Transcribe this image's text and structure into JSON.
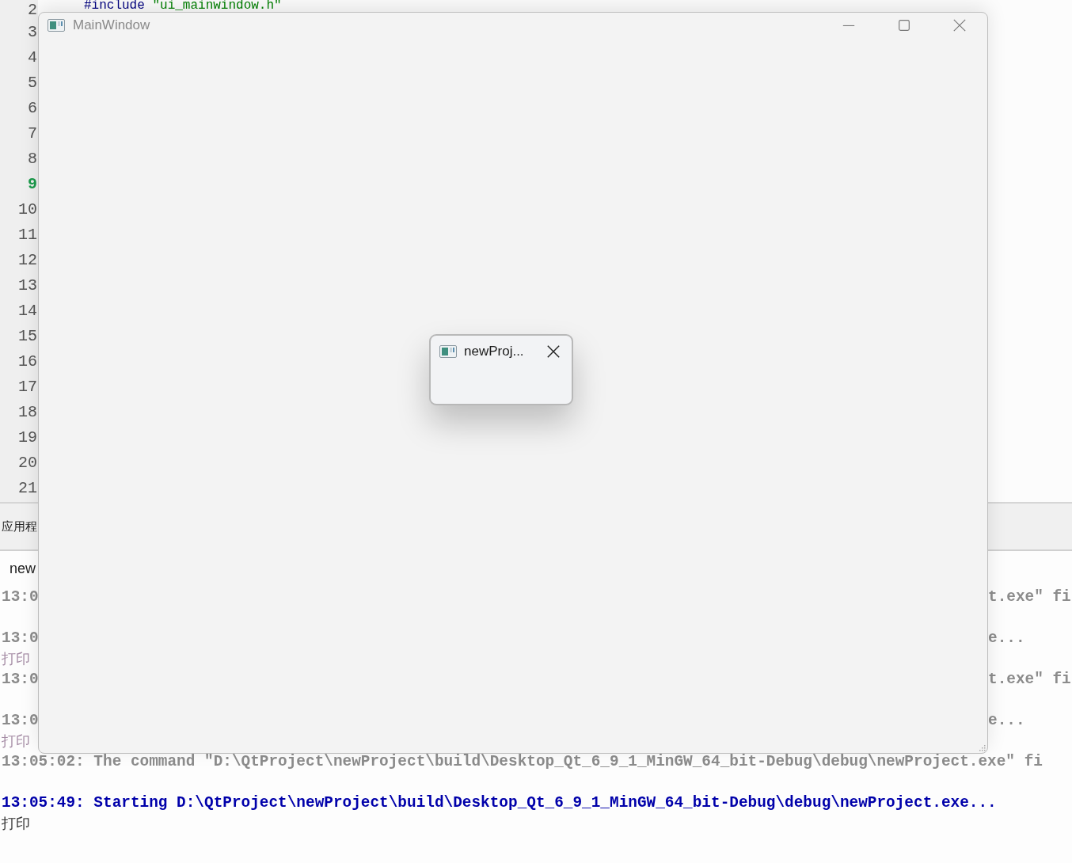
{
  "editor": {
    "code_line": {
      "directive": "#include",
      "string": "\"ui_mainwindow.h\""
    },
    "line_numbers": [
      {
        "number": "2",
        "current": false
      },
      {
        "number": "3",
        "current": false
      },
      {
        "number": "4",
        "current": false
      },
      {
        "number": "5",
        "current": false
      },
      {
        "number": "6",
        "current": false
      },
      {
        "number": "7",
        "current": false
      },
      {
        "number": "8",
        "current": false
      },
      {
        "number": "9",
        "current": true
      },
      {
        "number": "10",
        "current": false
      },
      {
        "number": "11",
        "current": false
      },
      {
        "number": "12",
        "current": false
      },
      {
        "number": "13",
        "current": false
      },
      {
        "number": "14",
        "current": false
      },
      {
        "number": "15",
        "current": false
      },
      {
        "number": "16",
        "current": false
      },
      {
        "number": "17",
        "current": false
      },
      {
        "number": "18",
        "current": false
      },
      {
        "number": "19",
        "current": false
      },
      {
        "number": "20",
        "current": false
      },
      {
        "number": "21",
        "current": false
      }
    ]
  },
  "output_pane": {
    "title": "应用程",
    "tab": "new",
    "lines": [
      {
        "kind": "message",
        "current": false,
        "left": "13:0",
        "right": "t.exe\" fi"
      },
      {
        "kind": "blank"
      },
      {
        "kind": "message",
        "current": false,
        "left": "13:0",
        "right": "e..."
      },
      {
        "kind": "print",
        "current": false,
        "text": "打印"
      },
      {
        "kind": "message",
        "current": false,
        "left": "13:0",
        "right": "t.exe\" fi"
      },
      {
        "kind": "blank"
      },
      {
        "kind": "message",
        "current": false,
        "left": "13:0",
        "right": "e..."
      },
      {
        "kind": "print",
        "current": false,
        "text": "打印"
      },
      {
        "kind": "message",
        "current": false,
        "text": "13:05:02: The command \"D:\\QtProject\\newProject\\build\\Desktop_Qt_6_9_1_MinGW_64_bit-Debug\\debug\\newProject.exe\" fi"
      },
      {
        "kind": "blank"
      },
      {
        "kind": "message",
        "current": true,
        "text": "13:05:49: Starting D:\\QtProject\\newProject\\build\\Desktop_Qt_6_9_1_MinGW_64_bit-Debug\\debug\\newProject.exe..."
      },
      {
        "kind": "print",
        "current": true,
        "text": "打印"
      }
    ]
  },
  "main_window": {
    "title": "MainWindow"
  },
  "dialog": {
    "title": "newProj..."
  }
}
